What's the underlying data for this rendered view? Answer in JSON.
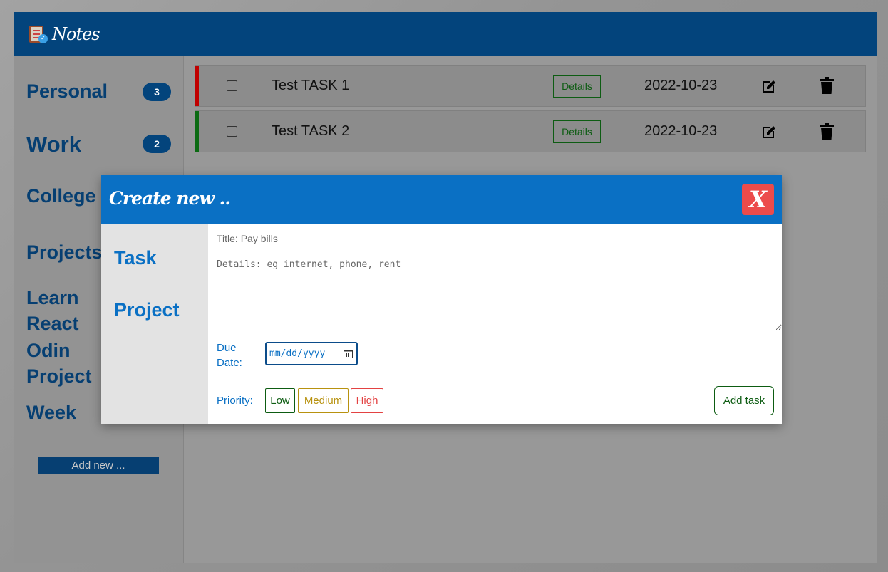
{
  "app": {
    "logo_text": "Notes"
  },
  "sidebar": {
    "items": [
      {
        "label": "Personal",
        "count": "3"
      },
      {
        "label": "Work",
        "count": "2"
      },
      {
        "label": "College"
      },
      {
        "label": "Projects"
      },
      {
        "label_lines": [
          "Learn",
          "React"
        ]
      },
      {
        "label_lines": [
          "Odin",
          "Project"
        ]
      },
      {
        "label": "Week"
      }
    ],
    "add_new_label": "Add new ..."
  },
  "tasks": [
    {
      "title": "Test TASK 1",
      "details_label": "Details",
      "date": "2022-10-23",
      "priority_color": "#c00000"
    },
    {
      "title": "Test TASK 2",
      "details_label": "Details",
      "date": "2022-10-23",
      "priority_color": "#0b6a12"
    }
  ],
  "modal": {
    "title": "Create new ..",
    "close_label": "X",
    "tabs": [
      "Task",
      "Project"
    ],
    "form": {
      "title_placeholder": "Title: Pay bills",
      "details_placeholder": "Details: eg internet, phone, rent",
      "due_date_label_lines": [
        "Due",
        "Date:"
      ],
      "date_placeholder": "mm/dd/yyyy",
      "priority_label": "Priority:",
      "priorities": [
        "Low",
        "Medium",
        "High"
      ],
      "submit_label": "Add task"
    }
  },
  "colors": {
    "header": "#03447c",
    "modal_header": "#0a70c4",
    "close": "#ec4b4b",
    "low": "#0d5c12",
    "medium": "#b8920f",
    "high": "#e34242"
  }
}
